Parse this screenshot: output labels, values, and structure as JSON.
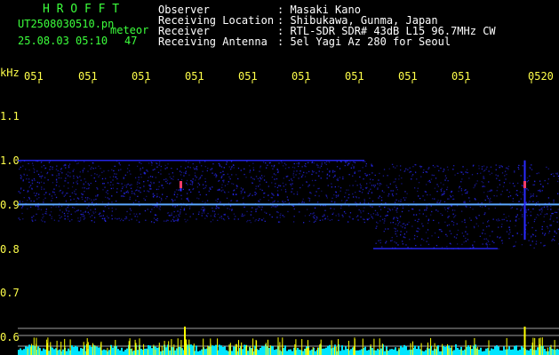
{
  "header": {
    "brand": "H R O F F T",
    "filename": "UT2508030510.pn",
    "meteor_label": "meteor",
    "datetime": "25.08.03 05:10",
    "meteor_count": "47",
    "rows": [
      {
        "label": "Observer",
        "value": ": Masaki Kano"
      },
      {
        "label": "Receiving Location",
        "value": ": Shibukawa, Gunma, Japan"
      },
      {
        "label": "Receiver",
        "value": ": RTL-SDR SDR# 43dB L15 96.7MHz CW"
      },
      {
        "label": "Receiving Antenna",
        "value": ": 5el Yagi Az 280 for Seoul"
      }
    ]
  },
  "colors": {
    "background": "#000000",
    "header_text": "#ffffff",
    "brand": "#3cff3c",
    "ticks": "#ffff4a",
    "signal": "#2a2aff",
    "carrier": "#5aa8ff",
    "meteor_head": "#ff3c6a",
    "grid_line": "#a0a0a0",
    "noise_floor": "#00e5ff",
    "spike": "#ffff00"
  },
  "chart_data": {
    "type": "heatmap",
    "ylabel": "kHz",
    "x_ticks": [
      "051",
      "051",
      "051",
      "051",
      "051",
      "051",
      "051",
      "051",
      "051",
      "0520"
    ],
    "y_ticks": [
      "1.1",
      "1.0",
      "0.9",
      "0.8",
      "0.7",
      "0.6"
    ],
    "ylim": [
      0.58,
      1.16
    ],
    "carrier_khz": 0.9,
    "band_upper_khz": 1.0,
    "band_lower_khz": 0.8,
    "meteor_events": [
      {
        "x_minute": 5.45,
        "khz_from": 0.93,
        "khz_to": 0.945
      },
      {
        "x_minute": 18.35,
        "khz_from": 0.82,
        "khz_to": 1.0
      }
    ],
    "spikes_x_minute": [
      5.6,
      18.35
    ]
  }
}
